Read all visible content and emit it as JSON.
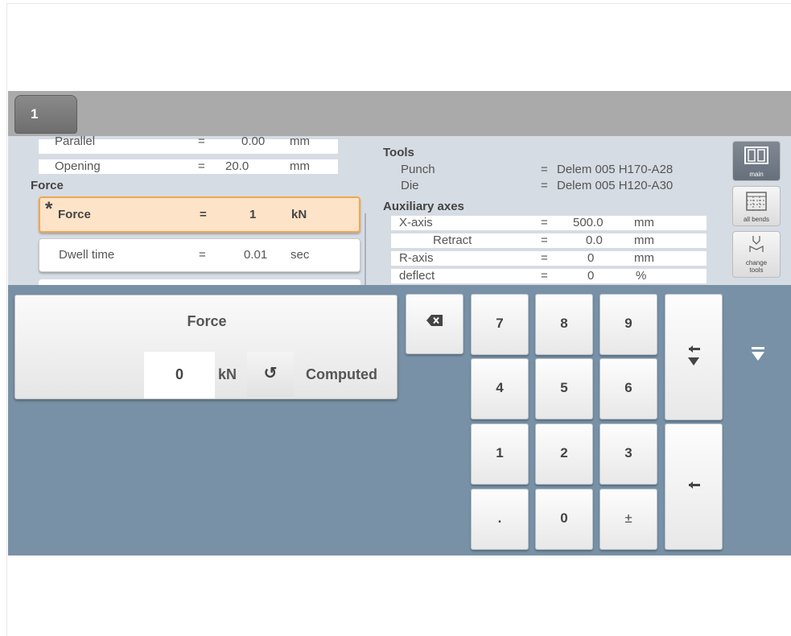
{
  "tab": {
    "label": "1"
  },
  "left_params": {
    "rows_top": [
      {
        "name": "Parallel",
        "eq": "=",
        "value": "0.00",
        "unit": "mm"
      },
      {
        "name": "Opening",
        "eq": "=",
        "value": "20.0",
        "unit": "mm"
      }
    ],
    "section_force": "Force",
    "cards": [
      {
        "marker": "*",
        "name": "Force",
        "eq": "=",
        "value": "1",
        "unit": "kN"
      },
      {
        "name": "Dwell time",
        "eq": "=",
        "value": "0.01",
        "unit": "sec"
      }
    ]
  },
  "right_params": {
    "tools_title": "Tools",
    "punch": {
      "name": "Punch",
      "eq": "=",
      "value": "Delem 005 H170-A28"
    },
    "die": {
      "name": "Die",
      "eq": "=",
      "value": "Delem 005 H120-A30"
    },
    "aux_title": "Auxiliary axes",
    "axes": [
      {
        "name": "X-axis",
        "eq": "=",
        "value": "500.0",
        "unit": "mm"
      },
      {
        "name": "Retract",
        "eq": "=",
        "value": "0.0",
        "unit": "mm"
      },
      {
        "name": "R-axis",
        "eq": "=",
        "value": "0",
        "unit": "mm"
      },
      {
        "name": "deflect",
        "eq": "=",
        "value": "0",
        "unit": "%"
      }
    ]
  },
  "side_buttons": [
    {
      "label": "main",
      "icon": "main-icon"
    },
    {
      "label": "all bends",
      "icon": "table-icon"
    },
    {
      "label": "change tools",
      "icon": "tools-icon"
    }
  ],
  "input": {
    "title": "Force",
    "value": "0",
    "unit": "kN",
    "undo_glyph": "↺",
    "computed_label": "Computed"
  },
  "keys": {
    "k7": "7",
    "k8": "8",
    "k9": "9",
    "k4": "4",
    "k5": "5",
    "k6": "6",
    "k1": "1",
    "k2": "2",
    "k3": "3",
    "kdot": ".",
    "k0": "0",
    "kpm": "±"
  }
}
